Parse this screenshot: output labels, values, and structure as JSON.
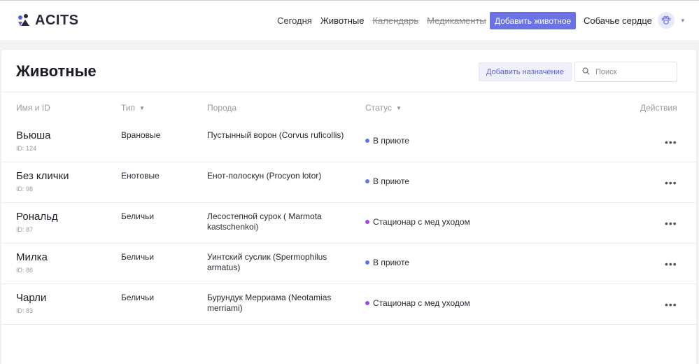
{
  "brand": {
    "name": "ACITS"
  },
  "nav": {
    "items": [
      {
        "label": "Сегодня",
        "state": "normal"
      },
      {
        "label": "Животные",
        "state": "active"
      },
      {
        "label": "Календарь",
        "state": "disabled"
      },
      {
        "label": "Медикаменты",
        "state": "disabled"
      }
    ],
    "add_animal_label": "Добавить животное"
  },
  "org": {
    "name": "Собачье сердце",
    "avatar_icon": "paw-icon"
  },
  "page": {
    "title": "Животные",
    "assign_label": "Добавить назначение",
    "search_placeholder": "Поиск"
  },
  "colors": {
    "accent": "#6b72e6",
    "status_shelter": "#6b72e6",
    "status_hospital": "#9b4be3"
  },
  "table": {
    "columns": {
      "name": "Имя и ID",
      "type": "Тип",
      "breed": "Порода",
      "status": "Статус",
      "actions": "Действия"
    },
    "rows": [
      {
        "name": "Вьюша",
        "id": "ID: 124",
        "type": "Врановые",
        "breed": "Пустынный ворон (Corvus ruficollis)",
        "status": "В приюте",
        "status_color": "#6b72e6"
      },
      {
        "name": "Без клички",
        "id": "ID: 98",
        "type": "Енотовые",
        "breed": "Енот-полоскун (Procyon lotor)",
        "status": "В приюте",
        "status_color": "#6b72e6"
      },
      {
        "name": "Рональд",
        "id": "ID: 87",
        "type": "Беличьи",
        "breed": "Лесостепной сурок ( Marmota kastschenkoi)",
        "status": "Стационар с мед уходом",
        "status_color": "#9b4be3"
      },
      {
        "name": "Милка",
        "id": "ID: 86",
        "type": "Беличьи",
        "breed": "Уинтский суслик (Spermophilus armatus)",
        "status": "В приюте",
        "status_color": "#6b72e6"
      },
      {
        "name": "Чарли",
        "id": "ID: 83",
        "type": "Беличьи",
        "breed": "Бурундук Мерриама (Neotamias merriami)",
        "status": "Стационар с мед уходом",
        "status_color": "#9b4be3"
      }
    ],
    "row_actions_glyph": "•••"
  }
}
